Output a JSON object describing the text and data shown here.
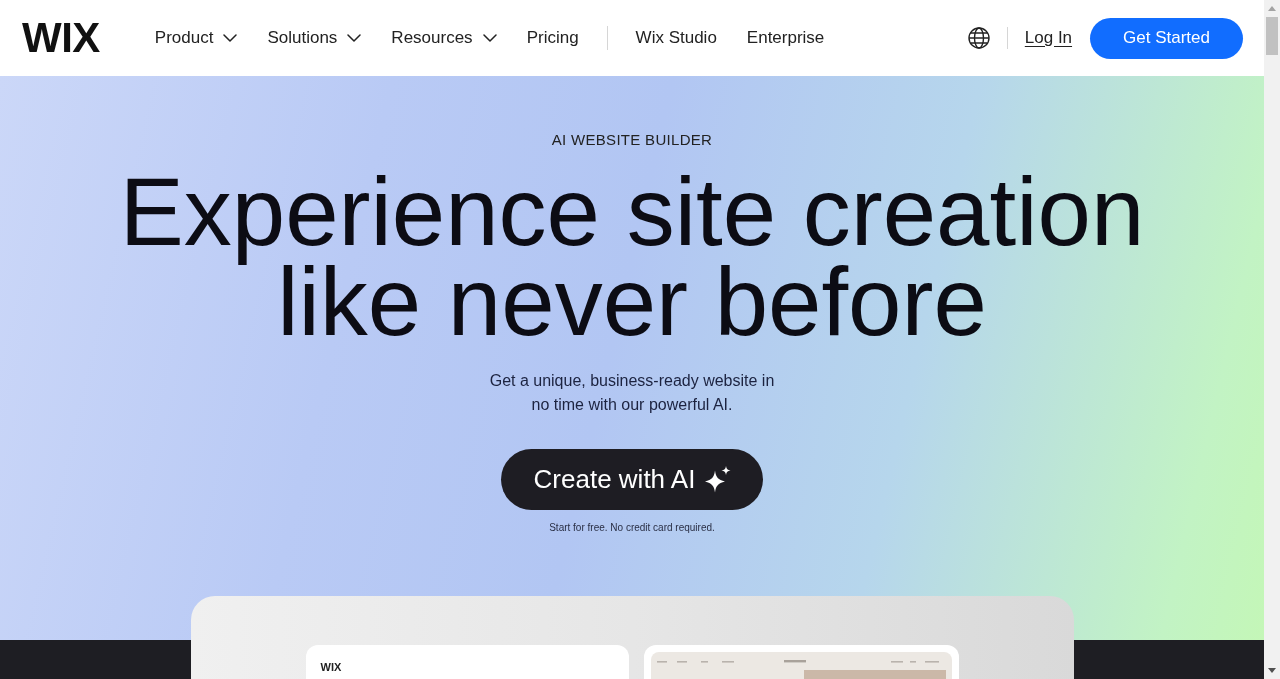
{
  "header": {
    "logo": "WIX",
    "nav_primary": [
      {
        "label": "Product",
        "has_menu": true
      },
      {
        "label": "Solutions",
        "has_menu": true
      },
      {
        "label": "Resources",
        "has_menu": true
      },
      {
        "label": "Pricing",
        "has_menu": false
      }
    ],
    "nav_secondary": [
      {
        "label": "Wix Studio"
      },
      {
        "label": "Enterprise"
      }
    ],
    "login": "Log In",
    "cta": "Get Started"
  },
  "hero": {
    "eyebrow": "AI WEBSITE BUILDER",
    "title": "Experience site creation like never before",
    "subtitle": "Get a unique, business-ready website in no time with our powerful AI.",
    "cta": "Create with AI",
    "note": "Start for free. No credit card required."
  },
  "preview": {
    "logo": "WIX"
  }
}
